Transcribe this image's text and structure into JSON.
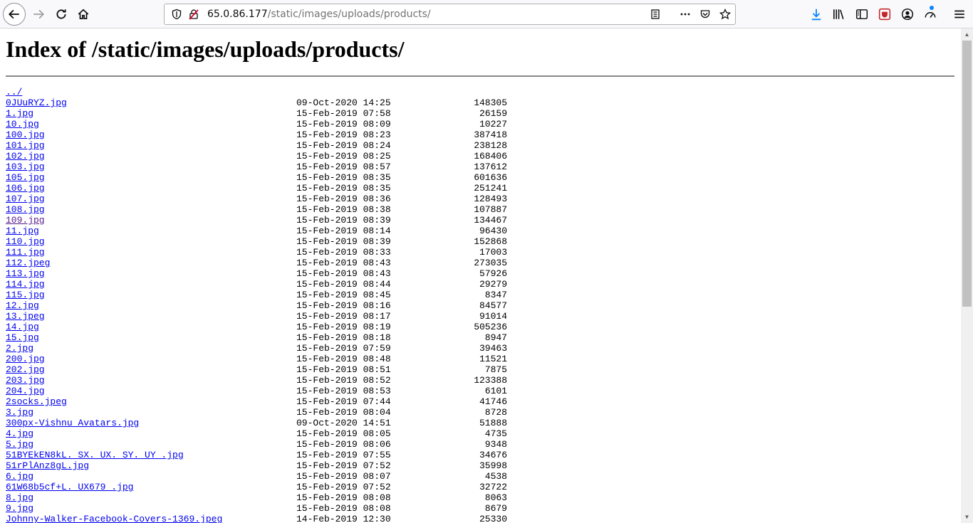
{
  "browser": {
    "url_host": "65.0.86.177",
    "url_path": "/static/images/uploads/products/"
  },
  "page": {
    "title": "Index of /static/images/uploads/products/",
    "parent_link": "../"
  },
  "files": [
    {
      "name": "0JUuRYZ.jpg",
      "date": "09-Oct-2020 14:25",
      "size": "148305"
    },
    {
      "name": "1.jpg",
      "date": "15-Feb-2019 07:58",
      "size": "26159"
    },
    {
      "name": "10.jpg",
      "date": "15-Feb-2019 08:09",
      "size": "10227"
    },
    {
      "name": "100.jpg",
      "date": "15-Feb-2019 08:23",
      "size": "387418"
    },
    {
      "name": "101.jpg",
      "date": "15-Feb-2019 08:24",
      "size": "238128"
    },
    {
      "name": "102.jpg",
      "date": "15-Feb-2019 08:25",
      "size": "168406"
    },
    {
      "name": "103.jpg",
      "date": "15-Feb-2019 08:57",
      "size": "137612"
    },
    {
      "name": "105.jpg",
      "date": "15-Feb-2019 08:35",
      "size": "601636"
    },
    {
      "name": "106.jpg",
      "date": "15-Feb-2019 08:35",
      "size": "251241"
    },
    {
      "name": "107.jpg",
      "date": "15-Feb-2019 08:36",
      "size": "128493"
    },
    {
      "name": "108.jpg",
      "date": "15-Feb-2019 08:38",
      "size": "107887"
    },
    {
      "name": "109.jpg",
      "date": "15-Feb-2019 08:39",
      "size": "134467",
      "visited": true
    },
    {
      "name": "11.jpg",
      "date": "15-Feb-2019 08:14",
      "size": "96430"
    },
    {
      "name": "110.jpg",
      "date": "15-Feb-2019 08:39",
      "size": "152868"
    },
    {
      "name": "111.jpg",
      "date": "15-Feb-2019 08:33",
      "size": "17003"
    },
    {
      "name": "112.jpeg",
      "date": "15-Feb-2019 08:43",
      "size": "273035"
    },
    {
      "name": "113.jpg",
      "date": "15-Feb-2019 08:43",
      "size": "57926"
    },
    {
      "name": "114.jpg",
      "date": "15-Feb-2019 08:44",
      "size": "29279"
    },
    {
      "name": "115.jpg",
      "date": "15-Feb-2019 08:45",
      "size": "8347"
    },
    {
      "name": "12.jpg",
      "date": "15-Feb-2019 08:16",
      "size": "84577"
    },
    {
      "name": "13.jpeg",
      "date": "15-Feb-2019 08:17",
      "size": "91014"
    },
    {
      "name": "14.jpg",
      "date": "15-Feb-2019 08:19",
      "size": "505236"
    },
    {
      "name": "15.jpg",
      "date": "15-Feb-2019 08:18",
      "size": "8947"
    },
    {
      "name": "2.jpg",
      "date": "15-Feb-2019 07:59",
      "size": "39463"
    },
    {
      "name": "200.jpg",
      "date": "15-Feb-2019 08:48",
      "size": "11521"
    },
    {
      "name": "202.jpg",
      "date": "15-Feb-2019 08:51",
      "size": "7875"
    },
    {
      "name": "203.jpg",
      "date": "15-Feb-2019 08:52",
      "size": "123388"
    },
    {
      "name": "204.jpg",
      "date": "15-Feb-2019 08:53",
      "size": "6101"
    },
    {
      "name": "2socks.jpeg",
      "date": "15-Feb-2019 07:44",
      "size": "41746"
    },
    {
      "name": "3.jpg",
      "date": "15-Feb-2019 08:04",
      "size": "8728"
    },
    {
      "name": "300px-Vishnu_Avatars.jpg",
      "date": "09-Oct-2020 14:51",
      "size": "51888"
    },
    {
      "name": "4.jpg",
      "date": "15-Feb-2019 08:05",
      "size": "4735"
    },
    {
      "name": "5.jpg",
      "date": "15-Feb-2019 08:06",
      "size": "9348"
    },
    {
      "name": "51BYEkEN8kL._SX._UX._SY._UY_.jpg",
      "date": "15-Feb-2019 07:55",
      "size": "34676"
    },
    {
      "name": "51rPlAnz8gL.jpg",
      "date": "15-Feb-2019 07:52",
      "size": "35998"
    },
    {
      "name": "6.jpg",
      "date": "15-Feb-2019 08:07",
      "size": "4538"
    },
    {
      "name": "61W68b5cf+L._UX679_.jpg",
      "date": "15-Feb-2019 07:52",
      "size": "32722"
    },
    {
      "name": "8.jpg",
      "date": "15-Feb-2019 08:08",
      "size": "8063"
    },
    {
      "name": "9.jpg",
      "date": "15-Feb-2019 08:08",
      "size": "8679"
    },
    {
      "name": "Johnny-Walker-Facebook-Covers-1369.jpeg",
      "date": "14-Feb-2019 12:30",
      "size": "25330"
    }
  ]
}
